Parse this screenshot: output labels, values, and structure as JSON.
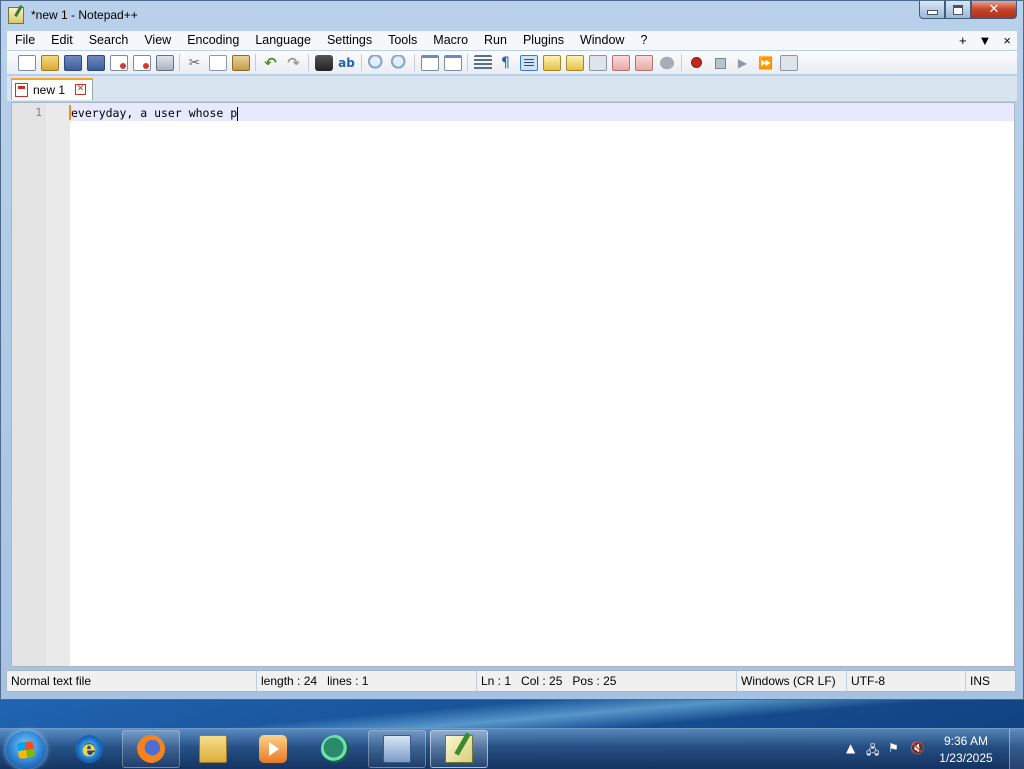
{
  "window": {
    "title": "*new 1 - Notepad++"
  },
  "menu": {
    "items": [
      "File",
      "Edit",
      "Search",
      "View",
      "Encoding",
      "Language",
      "Settings",
      "Tools",
      "Macro",
      "Run",
      "Plugins",
      "Window",
      "?"
    ],
    "right": [
      "+",
      "▼",
      "×"
    ]
  },
  "toolbar": {
    "icons": [
      "new-file-icon",
      "open-file-icon",
      "save-icon",
      "save-all-icon",
      "close-icon",
      "close-all-icon",
      "print-icon",
      "cut-icon",
      "copy-icon",
      "paste-icon",
      "undo-icon",
      "redo-icon",
      "find-icon",
      "replace-icon",
      "zoom-in-icon",
      "zoom-out-icon",
      "sync-vertical-icon",
      "sync-horizontal-icon",
      "word-wrap-icon",
      "show-all-chars-icon",
      "indent-guide-icon",
      "user-define-icon",
      "doc-map-icon",
      "function-list-icon",
      "folder-as-workspace-icon",
      "monitoring-icon",
      "start-recording-icon",
      "stop-recording-icon",
      "playback-icon",
      "run-macro-multiple-icon",
      "save-macro-icon"
    ]
  },
  "tabs": [
    {
      "label": "new 1",
      "close": "✕"
    }
  ],
  "editor": {
    "lines": [
      {
        "number": "1",
        "text": "everyday, a user whose p"
      }
    ]
  },
  "status": {
    "file_type": "Normal text file",
    "length": "length : 24",
    "lines": "lines : 1",
    "ln": "Ln : 1",
    "col": "Col : 25",
    "pos": "Pos : 25",
    "eol": "Windows (CR LF)",
    "encoding": "UTF-8",
    "mode": "INS"
  },
  "taskbar": {
    "apps": [
      "internet-explorer-icon",
      "firefox-icon",
      "file-explorer-icon",
      "media-player-icon",
      "chat-app-icon",
      "setup-app-icon",
      "notepad-plus-plus-icon"
    ],
    "time": "9:36 AM",
    "date": "1/23/2025"
  }
}
